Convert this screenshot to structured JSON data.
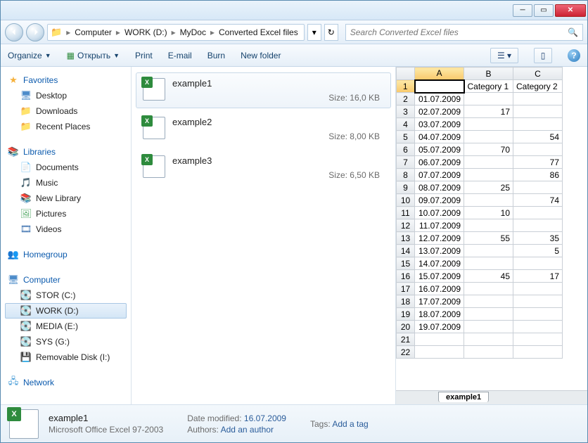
{
  "breadcrumb": {
    "seg0": "Computer",
    "seg1": "WORK (D:)",
    "seg2": "MyDoc",
    "seg3": "Converted Excel files"
  },
  "search": {
    "placeholder": "Search Converted Excel files"
  },
  "toolbar": {
    "organize": "Organize",
    "open": "Открыть",
    "print": "Print",
    "email": "E-mail",
    "burn": "Burn",
    "newfolder": "New folder"
  },
  "sidebar": {
    "favorites": "Favorites",
    "desktop": "Desktop",
    "downloads": "Downloads",
    "recent": "Recent Places",
    "libraries": "Libraries",
    "documents": "Documents",
    "music": "Music",
    "newlib": "New Library",
    "pictures": "Pictures",
    "videos": "Videos",
    "homegroup": "Homegroup",
    "computer": "Computer",
    "stor": "STOR (C:)",
    "work": "WORK (D:)",
    "media": "MEDIA (E:)",
    "sys": "SYS (G:)",
    "removable": "Removable Disk (I:)",
    "network": "Network"
  },
  "files": {
    "f0": {
      "name": "example1",
      "size": "Size: 16,0 KB"
    },
    "f1": {
      "name": "example2",
      "size": "Size: 8,00 KB"
    },
    "f2": {
      "name": "example3",
      "size": "Size: 6,50 KB"
    }
  },
  "preview": {
    "headers": {
      "a": "A",
      "b": "B",
      "c": "C",
      "cat1": "Category 1",
      "cat2": "Category 2"
    },
    "rows": {
      "r1": {
        "n": "1",
        "a": "",
        "b": "Category 1",
        "c": "Category 2"
      },
      "r2": {
        "n": "2",
        "a": "01.07.2009",
        "b": "",
        "c": ""
      },
      "r3": {
        "n": "3",
        "a": "02.07.2009",
        "b": "17",
        "c": ""
      },
      "r4": {
        "n": "4",
        "a": "03.07.2009",
        "b": "",
        "c": ""
      },
      "r5": {
        "n": "5",
        "a": "04.07.2009",
        "b": "",
        "c": "54"
      },
      "r6": {
        "n": "6",
        "a": "05.07.2009",
        "b": "70",
        "c": ""
      },
      "r7": {
        "n": "7",
        "a": "06.07.2009",
        "b": "",
        "c": "77"
      },
      "r8": {
        "n": "8",
        "a": "07.07.2009",
        "b": "",
        "c": "86"
      },
      "r9": {
        "n": "9",
        "a": "08.07.2009",
        "b": "25",
        "c": ""
      },
      "r10": {
        "n": "10",
        "a": "09.07.2009",
        "b": "",
        "c": "74"
      },
      "r11": {
        "n": "11",
        "a": "10.07.2009",
        "b": "10",
        "c": ""
      },
      "r12": {
        "n": "12",
        "a": "11.07.2009",
        "b": "",
        "c": ""
      },
      "r13": {
        "n": "13",
        "a": "12.07.2009",
        "b": "55",
        "c": "35"
      },
      "r14": {
        "n": "14",
        "a": "13.07.2009",
        "b": "",
        "c": "5"
      },
      "r15": {
        "n": "15",
        "a": "14.07.2009",
        "b": "",
        "c": ""
      },
      "r16": {
        "n": "16",
        "a": "15.07.2009",
        "b": "45",
        "c": "17"
      },
      "r17": {
        "n": "17",
        "a": "16.07.2009",
        "b": "",
        "c": ""
      },
      "r18": {
        "n": "18",
        "a": "17.07.2009",
        "b": "",
        "c": ""
      },
      "r19": {
        "n": "19",
        "a": "18.07.2009",
        "b": "",
        "c": ""
      },
      "r20": {
        "n": "20",
        "a": "19.07.2009",
        "b": "",
        "c": ""
      },
      "r21": {
        "n": "21",
        "a": "",
        "b": "",
        "c": ""
      },
      "r22": {
        "n": "22",
        "a": "",
        "b": "",
        "c": ""
      }
    },
    "sheet": "example1"
  },
  "details": {
    "name": "example1",
    "type": "Microsoft Office Excel 97-2003",
    "modlabel": "Date modified:",
    "modval": "16.07.2009",
    "authlabel": "Authors:",
    "authval": "Add an author",
    "tagslabel": "Tags:",
    "tagsval": "Add a tag"
  }
}
